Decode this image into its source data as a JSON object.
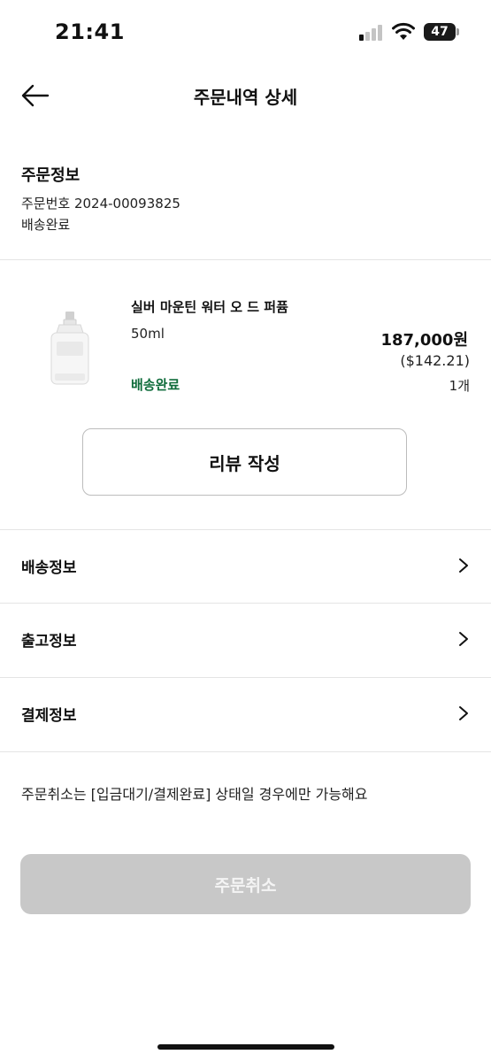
{
  "status_bar": {
    "time": "21:41",
    "battery": "47"
  },
  "header": {
    "title": "주문내역 상세"
  },
  "order_info": {
    "section_title": "주문정보",
    "order_number": "주문번호 2024-00093825",
    "status": "배송완료"
  },
  "product": {
    "name": "실버 마운틴 워터 오 드 퍼퓸",
    "option": "50ml",
    "price": "187,000원",
    "price_usd": "($142.21)",
    "status": "배송완료",
    "quantity": "1개",
    "status_color": "#0e6b3a"
  },
  "review_button": {
    "label": "리뷰 작성"
  },
  "info_rows": [
    {
      "label": "배송정보"
    },
    {
      "label": "출고정보"
    },
    {
      "label": "결제정보"
    }
  ],
  "notice": "주문취소는 [입금대기/결제완료] 상태일 경우에만 가능해요",
  "cancel_button": {
    "label": "주문취소",
    "state": "disabled"
  },
  "colors": {
    "accent_green": "#0e6b3a",
    "disabled_gray": "#c8c8c8"
  }
}
